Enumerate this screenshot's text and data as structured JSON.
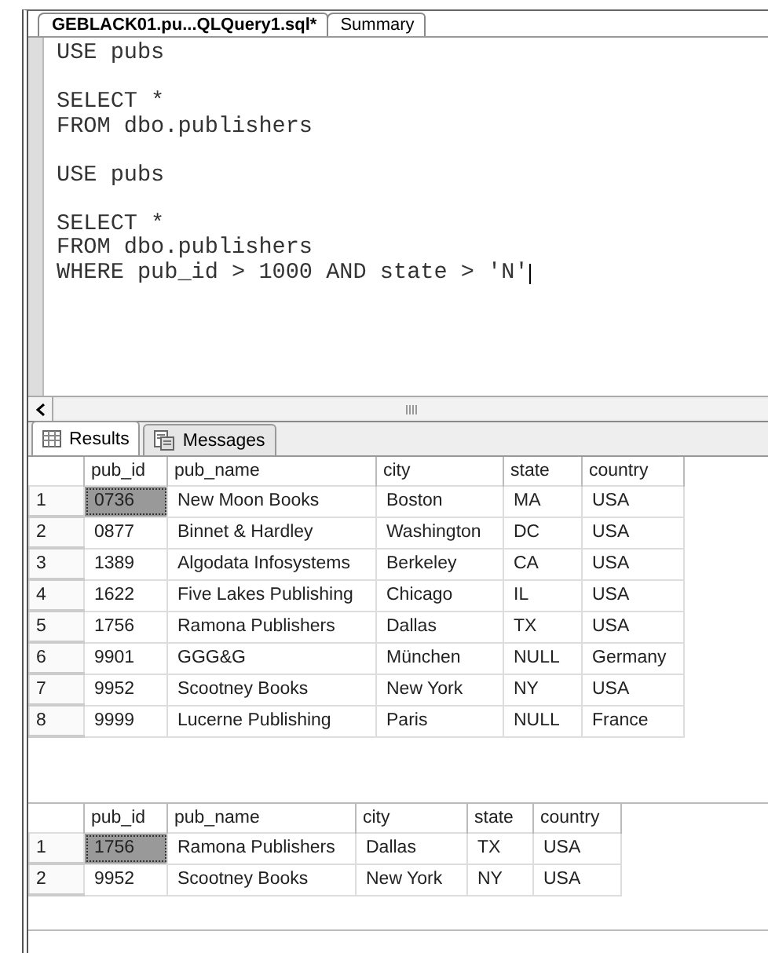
{
  "editor_tabs": [
    {
      "label": "GEBLACK01.pu...QLQuery1.sql*",
      "selected": true
    },
    {
      "label": "Summary",
      "selected": false
    }
  ],
  "code_blocks": [
    [
      "USE pubs"
    ],
    [
      "SELECT *",
      "FROM dbo.publishers"
    ],
    [
      "USE pubs"
    ],
    [
      "SELECT *",
      "FROM dbo.publishers",
      "WHERE pub_id > 1000 AND state > 'N'"
    ]
  ],
  "result_tabs": [
    {
      "label": "Results",
      "kind": "grid",
      "selected": true
    },
    {
      "label": "Messages",
      "kind": "messages",
      "selected": false
    }
  ],
  "grids": [
    {
      "columns": [
        "pub_id",
        "pub_name",
        "city",
        "state",
        "country"
      ],
      "rows": [
        {
          "number": "1",
          "selected": true,
          "cells": [
            "0736",
            "New Moon Books",
            "Boston",
            "MA",
            "USA"
          ]
        },
        {
          "number": "2",
          "selected": false,
          "cells": [
            "0877",
            "Binnet & Hardley",
            "Washington",
            "DC",
            "USA"
          ]
        },
        {
          "number": "3",
          "selected": false,
          "cells": [
            "1389",
            "Algodata Infosystems",
            "Berkeley",
            "CA",
            "USA"
          ]
        },
        {
          "number": "4",
          "selected": false,
          "cells": [
            "1622",
            "Five Lakes Publishing",
            "Chicago",
            "IL",
            "USA"
          ]
        },
        {
          "number": "5",
          "selected": false,
          "cells": [
            "1756",
            "Ramona Publishers",
            "Dallas",
            "TX",
            "USA"
          ]
        },
        {
          "number": "6",
          "selected": false,
          "cells": [
            "9901",
            "GGG&G",
            "München",
            "NULL",
            "Germany"
          ]
        },
        {
          "number": "7",
          "selected": false,
          "cells": [
            "9952",
            "Scootney Books",
            "New York",
            "NY",
            "USA"
          ]
        },
        {
          "number": "8",
          "selected": false,
          "cells": [
            "9999",
            "Lucerne Publishing",
            "Paris",
            "NULL",
            "France"
          ]
        }
      ]
    },
    {
      "columns": [
        "pub_id",
        "pub_name",
        "city",
        "state",
        "country"
      ],
      "rows": [
        {
          "number": "1",
          "selected": true,
          "cells": [
            "1756",
            "Ramona Publishers",
            "Dallas",
            "TX",
            "USA"
          ]
        },
        {
          "number": "2",
          "selected": false,
          "cells": [
            "9952",
            "Scootney Books",
            "New York",
            "NY",
            "USA"
          ]
        }
      ]
    }
  ]
}
